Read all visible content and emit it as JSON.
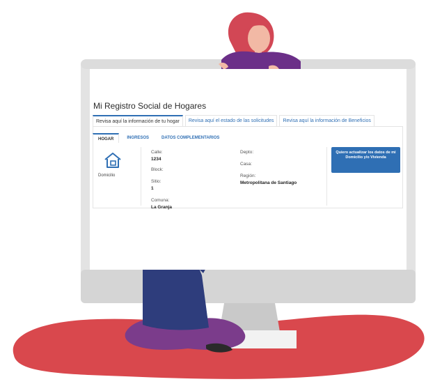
{
  "page": {
    "title": "Mi Registro Social de Hogares"
  },
  "top_tabs": [
    {
      "label": "Revisa aquí la información de tu hogar"
    },
    {
      "label": "Revisa aquí el estado de las solicitudes"
    },
    {
      "label": "Revisa aquí la información de Beneficios"
    }
  ],
  "sub_tabs": [
    {
      "label": "HOGAR"
    },
    {
      "label": "INGRESOS"
    },
    {
      "label": "DATOS COMPLEMENTARIOS"
    }
  ],
  "home_section": {
    "icon": "house-icon",
    "label": "Domicilio"
  },
  "fields": {
    "calle_label": "Calle:",
    "calle_value": "1234",
    "block_label": "Block:",
    "sitio_label": "Sitio:",
    "sitio_value": "1",
    "comuna_label": "Comuna:",
    "comuna_value": "La Granja",
    "depto_label": "Depto:",
    "casa_label": "Casa:",
    "region_label": "Región:",
    "region_value": "Metropolitana de Santiago"
  },
  "update_button": {
    "label": "Quiero actualizar los datos de mi Domicilio y/o Vivienda"
  },
  "colors": {
    "accent": "#2f6fb4",
    "monitor": "#e3e3e3",
    "rug": "#d9484d",
    "shirt": "#2e3d7c",
    "pants": "#7b3c8b",
    "woman_hair": "#d24755",
    "woman_shirt": "#6b2f88"
  }
}
